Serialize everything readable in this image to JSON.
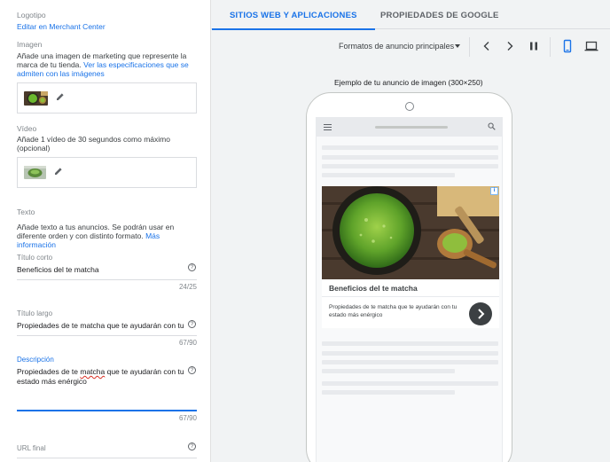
{
  "left": {
    "logo_label": "Logotipo",
    "logo_link": "Editar en Merchant Center",
    "image_label": "Imagen",
    "image_desc": "Añade una imagen de marketing que represente la marca de tu tienda.",
    "image_desc_link": "Ver las especificaciones que se admiten con las imágenes",
    "video_label": "Vídeo",
    "video_desc": "Añade 1 vídeo de 30 segundos como máximo (opcional)",
    "text_label": "Texto",
    "text_desc": "Añade texto a tus anuncios. Se podrán usar en diferente orden y con distinto formato.",
    "text_desc_link": "Más información",
    "short_title": {
      "label": "Título corto",
      "value": "Beneficios del te matcha",
      "count": "24/25"
    },
    "long_title": {
      "label": "Título largo",
      "value": "Propiedades de te matcha que te ayudarán con tu",
      "count": "67/90"
    },
    "description": {
      "label": "Descripción",
      "value_before": "Propiedades de te ",
      "value_misspelled": "matcha",
      "value_after": " que te ayudarán con tu estado más enérgico",
      "count": "67/90"
    },
    "final_url": {
      "label": "URL final"
    },
    "help_glyph": "?"
  },
  "right": {
    "tabs": [
      {
        "label": "SITIOS WEB Y APLICACIONES",
        "active": true
      },
      {
        "label": "PROPIEDADES DE GOOGLE",
        "active": false
      }
    ],
    "format_select": "Formatos de anuncio principales",
    "icons": [
      "chevron-left-icon",
      "chevron-right-icon",
      "pause-icon",
      "mobile-icon",
      "desktop-icon"
    ],
    "preview_caption": "Ejemplo de tu anuncio de imagen (300×250)",
    "ad": {
      "title": "Beneficios del te matcha",
      "body": "Propiedades de te matcha que te ayudarán con tu estado más enérgico",
      "info_glyph": "i"
    }
  },
  "colors": {
    "accent": "#1a73e8",
    "panel_bg": "#f1f3f4",
    "border": "#dadce0",
    "error_underline": "#d93025"
  }
}
